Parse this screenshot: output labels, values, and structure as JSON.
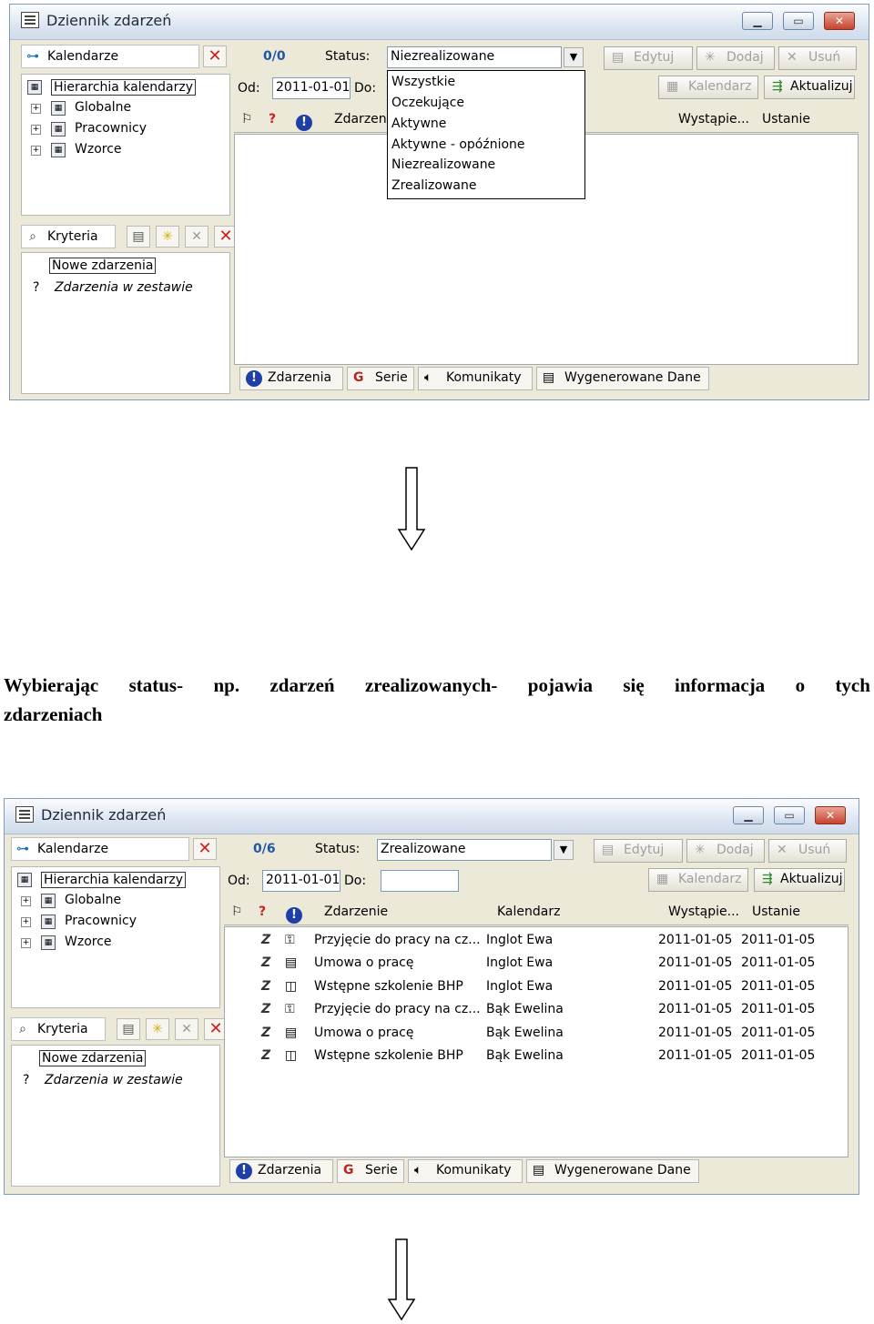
{
  "caption": {
    "line1_words": [
      "Wybierając",
      "status-",
      "np.",
      "zdarzeń",
      "zrealizowanych-",
      "pojawia",
      "się",
      "informacja",
      "o",
      "tych"
    ],
    "line2": "zdarzeniach"
  },
  "screen1": {
    "window_title": "Dziennik zdarzeń",
    "kalendarze_label": "Kalendarze",
    "tree": [
      "Hierarchia kalendarzy",
      "Globalne",
      "Pracownicy",
      "Wzorce"
    ],
    "kryteria_label": "Kryteria",
    "criteria": [
      "Nowe zdarzenia",
      "Zdarzenia w zestawie"
    ],
    "criteria_prefix": "?",
    "count": "0/0",
    "status_label": "Status:",
    "status_value": "Niezrealizowane",
    "od_label": "Od:",
    "od_value": "2011-01-01",
    "do_label": "Do:",
    "btn_edytuj": "Edytuj",
    "btn_dodaj": "Dodaj",
    "btn_usun": "Usuń",
    "btn_kalendarz": "Kalendarz",
    "btn_aktualizuj": "Aktualizuj",
    "col_zdarzenie": "Zdarzen",
    "col_wystapienie": "Wystąpie...",
    "col_ustanie": "Ustanie",
    "dropdown_options": [
      "Wszystkie",
      "Oczekujące",
      "Aktywne",
      "Aktywne - opóźnione",
      "Niezrealizowane",
      "Zrealizowane"
    ],
    "tabs": [
      "Zdarzenia",
      "Serie",
      "Komunikaty",
      "Wygenerowane Dane"
    ]
  },
  "screen2": {
    "window_title": "Dziennik zdarzeń",
    "kalendarze_label": "Kalendarze",
    "tree": [
      "Hierarchia kalendarzy",
      "Globalne",
      "Pracownicy",
      "Wzorce"
    ],
    "kryteria_label": "Kryteria",
    "criteria": [
      "Nowe zdarzenia",
      "Zdarzenia w zestawie"
    ],
    "criteria_prefix": "?",
    "count": "0/6",
    "status_label": "Status:",
    "status_value": "Zrealizowane",
    "od_label": "Od:",
    "od_value": "2011-01-01",
    "do_label": "Do:",
    "btn_edytuj": "Edytuj",
    "btn_dodaj": "Dodaj",
    "btn_usun": "Usuń",
    "btn_kalendarz": "Kalendarz",
    "btn_aktualizuj": "Aktualizuj",
    "col_zdarzenie": "Zdarzenie",
    "col_kalendarz": "Kalendarz",
    "col_wystapienie": "Wystąpie...",
    "col_ustanie": "Ustanie",
    "rows": [
      {
        "flag": "Z",
        "name": "Przyjęcie do pracy na cz...",
        "cal": "Inglot Ewa",
        "from": "2011-01-05",
        "to": "2011-01-05"
      },
      {
        "flag": "Z",
        "name": "Umowa o pracę",
        "cal": "Inglot Ewa",
        "from": "2011-01-05",
        "to": "2011-01-05"
      },
      {
        "flag": "Z",
        "name": "Wstępne szkolenie BHP",
        "cal": "Inglot Ewa",
        "from": "2011-01-05",
        "to": "2011-01-05"
      },
      {
        "flag": "Z",
        "name": "Przyjęcie do pracy na cz...",
        "cal": "Bąk Ewelina",
        "from": "2011-01-05",
        "to": "2011-01-05"
      },
      {
        "flag": "Z",
        "name": "Umowa o pracę",
        "cal": "Bąk Ewelina",
        "from": "2011-01-05",
        "to": "2011-01-05"
      },
      {
        "flag": "Z",
        "name": "Wstępne szkolenie BHP",
        "cal": "Bąk Ewelina",
        "from": "2011-01-05",
        "to": "2011-01-05"
      }
    ],
    "tabs": [
      "Zdarzenia",
      "Serie",
      "Komunikaty",
      "Wygenerowane Dane"
    ]
  }
}
